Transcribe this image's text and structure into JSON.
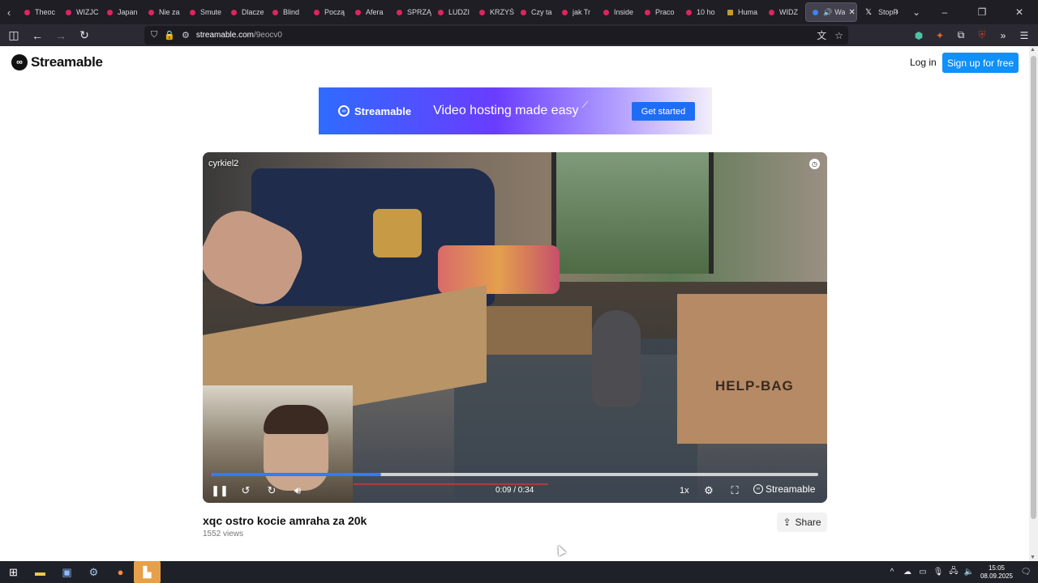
{
  "browser": {
    "tabs": [
      {
        "label": "Theoc",
        "favicon": "rss-icon"
      },
      {
        "label": "WIZJC",
        "favicon": "rss-icon"
      },
      {
        "label": "Japan",
        "favicon": "rss-icon"
      },
      {
        "label": "Nie za",
        "favicon": "rss-icon"
      },
      {
        "label": "Smute",
        "favicon": "rss-icon"
      },
      {
        "label": "Dlacze",
        "favicon": "rss-icon"
      },
      {
        "label": "Blind",
        "favicon": "rss-icon"
      },
      {
        "label": "Począ",
        "favicon": "rss-icon"
      },
      {
        "label": "Afera",
        "favicon": "rss-icon"
      },
      {
        "label": "SPRZĄ",
        "favicon": "rss-icon"
      },
      {
        "label": "LUDZI",
        "favicon": "rss-icon"
      },
      {
        "label": "KRZYŚ",
        "favicon": "rss-icon"
      },
      {
        "label": "Czy ta",
        "favicon": "rss-icon"
      },
      {
        "label": "jak Tr",
        "favicon": "rss-icon"
      },
      {
        "label": "Inside",
        "favicon": "rss-icon"
      },
      {
        "label": "Praco",
        "favicon": "rss-icon"
      },
      {
        "label": "10 ho",
        "favicon": "rss-icon"
      },
      {
        "label": "Huma",
        "favicon": "bookmark-icon"
      },
      {
        "label": "WIDZ",
        "favicon": "rss-icon"
      }
    ],
    "active_tab": {
      "label": "Wa"
    },
    "extra_tab": {
      "label": "StopP"
    },
    "url_host": "streamable.com",
    "url_path": "/9eocv0"
  },
  "site": {
    "brand": "Streamable",
    "login_label": "Log in",
    "signup_label": "Sign up for free"
  },
  "banner": {
    "brand": "Streamable",
    "tagline": "Video hosting made easy",
    "cta": "Get started"
  },
  "video": {
    "uploader": "cyrkiel2",
    "scene_text": "HELP-BAG",
    "time": "0:09 / 0:34",
    "speed": "1x",
    "brand": "Streamable",
    "progress": {
      "played": 0.28,
      "buffered": 0.28
    }
  },
  "meta": {
    "title": "xqc ostro kocie amraha za 20k",
    "views": "1552 views",
    "share_label": "Share"
  },
  "taskbar": {
    "time": "15:05",
    "date": "08.09.2025"
  },
  "colors": {
    "brand_blue": "#0f90fa",
    "progress_blue": "#2e7dfa"
  }
}
